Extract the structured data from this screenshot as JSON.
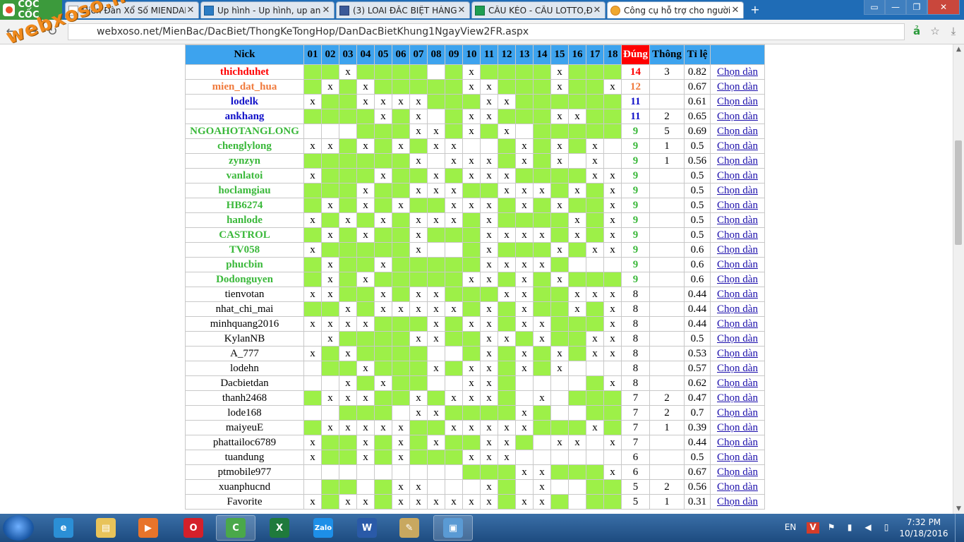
{
  "browser": {
    "logo_text": "CỐC CỐC",
    "tabs": [
      {
        "label": "Diễn Đàn Xổ Số MIENDAN",
        "icon": "page-icon"
      },
      {
        "label": "Up hình - Up hình, up anh",
        "icon": "picture-icon"
      },
      {
        "label": "(3) LOAI ĐẮC BIỆT HÀNG N",
        "icon": "facebook-icon"
      },
      {
        "label": "CẦU KÈO - CẦU LOTTO,ĐÁ",
        "icon": "sheet-icon"
      },
      {
        "label": "Công cụ hỗ trợ cho người",
        "icon": "xs-icon",
        "active": true
      }
    ],
    "url": "webxoso.net/MienBac/DacBiet/ThongKeTongHop/DanDacBietKhung1NgayView2FR.aspx",
    "watermark": "webxoso.net"
  },
  "table": {
    "headers": {
      "nick": "Nick",
      "days": [
        "01",
        "02",
        "03",
        "04",
        "05",
        "06",
        "07",
        "08",
        "09",
        "10",
        "11",
        "12",
        "13",
        "14",
        "15",
        "16",
        "17",
        "18"
      ],
      "dung": "Đúng",
      "thong": "Thông",
      "tile": "Tỉ lệ"
    },
    "link_label": "Chọn dàn",
    "rows": [
      {
        "nick": "thichduhet",
        "color": "#ff0000",
        "bold": true,
        "cells": "GGxGGGGWGxGGGGxGGG",
        "dung": "14",
        "dung_color": "#ff0000",
        "thong": "3",
        "tile": "0.82"
      },
      {
        "nick": "mien_dat_hua",
        "color": "#f07a3c",
        "bold": true,
        "cells": "GxGxGGGGGxxGGGxGGx",
        "dung": "12",
        "dung_color": "#f07a3c",
        "thong": "",
        "tile": "0.67"
      },
      {
        "nick": "lodelk",
        "color": "#1010c8",
        "bold": true,
        "cells": "xGGxxxxGGGxxGGGGGG",
        "dung": "11",
        "dung_color": "#1010c8",
        "thong": "",
        "tile": "0.61"
      },
      {
        "nick": "ankhang",
        "color": "#1010c8",
        "bold": true,
        "cells": "GGGGxGxWGxxGGGxxGG",
        "dung": "11",
        "dung_color": "#1010c8",
        "thong": "2",
        "tile": "0.65"
      },
      {
        "nick": "NGOAHOTANGLONG",
        "color": "#3ab83a",
        "bold": true,
        "cells": "WWWGGGxxGxGxWGGGGG",
        "dung": "9",
        "dung_color": "#3ab83a",
        "thong": "5",
        "tile": "0.69"
      },
      {
        "nick": "chenglylong",
        "color": "#3ab83a",
        "bold": true,
        "cells": "xxGxGxGxxWWGxGxGxW",
        "dung": "9",
        "dung_color": "#3ab83a",
        "thong": "1",
        "tile": "0.5"
      },
      {
        "nick": "zynzyn",
        "color": "#3ab83a",
        "bold": true,
        "cells": "GGGGGGxWxxxGxGxWxW",
        "dung": "9",
        "dung_color": "#3ab83a",
        "thong": "1",
        "tile": "0.56"
      },
      {
        "nick": "vanlatoi",
        "color": "#3ab83a",
        "bold": true,
        "cells": "xGGGxGGxGxxxGGGGxx",
        "dung": "9",
        "dung_color": "#3ab83a",
        "thong": "",
        "tile": "0.5"
      },
      {
        "nick": "hoclamgiau",
        "color": "#3ab83a",
        "bold": true,
        "cells": "GGGxGGxxxGGxxxGxGx",
        "dung": "9",
        "dung_color": "#3ab83a",
        "thong": "",
        "tile": "0.5"
      },
      {
        "nick": "HB6274",
        "color": "#3ab83a",
        "bold": true,
        "cells": "GxGxGxGGxxxGxGxGGx",
        "dung": "9",
        "dung_color": "#3ab83a",
        "thong": "",
        "tile": "0.5"
      },
      {
        "nick": "hanlode",
        "color": "#3ab83a",
        "bold": true,
        "cells": "xGxGxGxxxGxGGGGxGx",
        "dung": "9",
        "dung_color": "#3ab83a",
        "thong": "",
        "tile": "0.5"
      },
      {
        "nick": "CASTROL",
        "color": "#3ab83a",
        "bold": true,
        "cells": "GxGxGGxGGGxxxxGxGx",
        "dung": "9",
        "dung_color": "#3ab83a",
        "thong": "",
        "tile": "0.5"
      },
      {
        "nick": "TV058",
        "color": "#3ab83a",
        "bold": true,
        "cells": "xGGGGGxWWGxGGGxGxx",
        "dung": "9",
        "dung_color": "#3ab83a",
        "thong": "",
        "tile": "0.6"
      },
      {
        "nick": "phucbin",
        "color": "#3ab83a",
        "bold": true,
        "cells": "GxGGxGGGGGxxxxGWWW",
        "dung": "9",
        "dung_color": "#3ab83a",
        "thong": "",
        "tile": "0.6"
      },
      {
        "nick": "Dodonguyen",
        "color": "#3ab83a",
        "bold": true,
        "cells": "GxGxGGGGGxxGxGxGGG",
        "dung": "9",
        "dung_color": "#3ab83a",
        "thong": "",
        "tile": "0.6"
      },
      {
        "nick": "tienvotan",
        "color": "#000000",
        "bold": false,
        "cells": "xxGGxGxxGGGxxGGxxx",
        "dung": "8",
        "dung_color": "#000000",
        "thong": "",
        "tile": "0.44"
      },
      {
        "nick": "nhat_chi_mai",
        "color": "#000000",
        "bold": false,
        "cells": "GGxGxxxxxGxGxGGxGx",
        "dung": "8",
        "dung_color": "#000000",
        "thong": "",
        "tile": "0.44"
      },
      {
        "nick": "minhquang2016",
        "color": "#000000",
        "bold": false,
        "cells": "xxxxGGGxGxxGxxGGGx",
        "dung": "8",
        "dung_color": "#000000",
        "thong": "",
        "tile": "0.44"
      },
      {
        "nick": "KylanNB",
        "color": "#000000",
        "bold": false,
        "cells": "WxGGGGxxGGxxGxGGxx",
        "dung": "8",
        "dung_color": "#000000",
        "thong": "",
        "tile": "0.5"
      },
      {
        "nick": "A_777",
        "color": "#000000",
        "bold": false,
        "cells": "xGxGGGGWWGxGxGxGxx",
        "dung": "8",
        "dung_color": "#000000",
        "thong": "",
        "tile": "0.53"
      },
      {
        "nick": "lodehn",
        "color": "#000000",
        "bold": false,
        "cells": "WGGxGGGxGxxGxGxWWW",
        "dung": "8",
        "dung_color": "#000000",
        "thong": "",
        "tile": "0.57"
      },
      {
        "nick": "Dacbietdan",
        "color": "#000000",
        "bold": false,
        "cells": "WWxGxGGWWxxGWWWWGx",
        "dung": "8",
        "dung_color": "#000000",
        "thong": "",
        "tile": "0.62"
      },
      {
        "nick": "thanh2468",
        "color": "#000000",
        "bold": false,
        "cells": "GxxxGGxGxxxGWxWGGG",
        "dung": "7",
        "dung_color": "#000000",
        "thong": "2",
        "tile": "0.47"
      },
      {
        "nick": "lode168",
        "color": "#000000",
        "bold": false,
        "cells": "WWGGGWxxGGGGxGWWGG",
        "dung": "7",
        "dung_color": "#000000",
        "thong": "2",
        "tile": "0.7"
      },
      {
        "nick": "maiyeuE",
        "color": "#000000",
        "bold": false,
        "cells": "GxxxxxGGxxxxxGGGxG",
        "dung": "7",
        "dung_color": "#000000",
        "thong": "1",
        "tile": "0.39"
      },
      {
        "nick": "phattailoc6789",
        "color": "#000000",
        "bold": false,
        "cells": "xGGxGxGxGGxxGWxxWx",
        "dung": "7",
        "dung_color": "#000000",
        "thong": "",
        "tile": "0.44"
      },
      {
        "nick": "tuandung",
        "color": "#000000",
        "bold": false,
        "cells": "xGGxGxGGGxxxWWWWWW",
        "dung": "6",
        "dung_color": "#000000",
        "thong": "",
        "tile": "0.5"
      },
      {
        "nick": "ptmobile977",
        "color": "#000000",
        "bold": false,
        "cells": "WWWWWWWWWGGGxxGGGx",
        "dung": "6",
        "dung_color": "#000000",
        "thong": "",
        "tile": "0.67"
      },
      {
        "nick": "xuanphucnd",
        "color": "#000000",
        "bold": false,
        "cells": "WGGWGxxWWWxGWxWWGG",
        "dung": "5",
        "dung_color": "#000000",
        "thong": "2",
        "tile": "0.56"
      },
      {
        "nick": "Favorite",
        "color": "#000000",
        "bold": false,
        "cells": "xGxxGxxxxxxGxxGWGG",
        "dung": "5",
        "dung_color": "#000000",
        "thong": "1",
        "tile": "0.31"
      }
    ]
  },
  "taskbar": {
    "apps": [
      {
        "name": "ie-icon",
        "label": "e",
        "color": "#2b8fd6"
      },
      {
        "name": "folder-icon",
        "label": "▤",
        "color": "#e8c35a"
      },
      {
        "name": "media-player-icon",
        "label": "▶",
        "color": "#e8742a"
      },
      {
        "name": "opera-icon",
        "label": "O",
        "color": "#d4202a"
      },
      {
        "name": "coccoc-icon",
        "label": "C",
        "color": "#4aa84a",
        "active": true
      },
      {
        "name": "excel-icon",
        "label": "X",
        "color": "#1f7a3c"
      },
      {
        "name": "zalo-icon",
        "label": "Zalo",
        "color": "#1d8fe8"
      },
      {
        "name": "word-icon",
        "label": "W",
        "color": "#2a5aa8"
      },
      {
        "name": "paint-icon",
        "label": "✎",
        "color": "#c8a860"
      },
      {
        "name": "picture-viewer-icon",
        "label": "▣",
        "color": "#5a9ad4",
        "active": true
      }
    ],
    "lang": "EN",
    "time": "7:32 PM",
    "date": "10/18/2016"
  }
}
